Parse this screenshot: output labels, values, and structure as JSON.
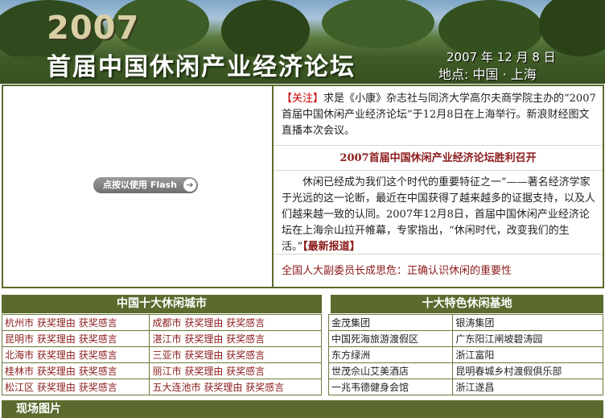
{
  "banner": {
    "year": "2007",
    "title": "首届中国休闲产业经济论坛",
    "date": "2007 年 12 月 8 日",
    "place": "地点: 中国 · 上海"
  },
  "flash": {
    "label": "点按以使用 Flash"
  },
  "news": {
    "tag": "【关注】",
    "intro": "求是《小康》杂志社与同济大学高尔夫商学院主办的“2007首届中国休闲产业经济论坛”于12月8日在上海举行。新浪财经图文直播本次会议。",
    "headline": "2007首届中国休闲产业经济论坛胜利召开",
    "body": "休闲已经成为我们这个时代的重要特征之一”——著名经济学家于光远的这一论断，最近在中国获得了越来越多的证据支持，以及人们越来越一致的认同。2007年12月8日，首届中国休闲产业经济论坛在上海佘山拉开帷幕，专家指出，“休闲时代，改变我们的生活。”",
    "more": "【最新报道】",
    "link": "全国人大副委员长成思危：正确认识休闲的重要性"
  },
  "cities": {
    "header": "中国十大休闲城市",
    "reason": "获奖理由",
    "speech": "获奖感言",
    "rows": [
      [
        "杭州市",
        "成都市"
      ],
      [
        "昆明市",
        "湛江市"
      ],
      [
        "北海市",
        "三亚市"
      ],
      [
        "桂林市",
        "丽江市"
      ],
      [
        "松江区",
        "五大连池市"
      ]
    ]
  },
  "bases": {
    "header": "十大特色休闲基地",
    "rows": [
      [
        "金茂集团",
        "银涛集团"
      ],
      [
        "中国死海旅游渡假区",
        "广东阳江闸坡碧涛园"
      ],
      [
        "东方绿洲",
        "浙江富阳"
      ],
      [
        "世茂佘山艾美酒店",
        "昆明春城乡村渡假俱乐部"
      ],
      [
        "一兆韦德健身会馆",
        "浙江遂昌"
      ]
    ]
  },
  "footer": {
    "label": "现场图片"
  }
}
